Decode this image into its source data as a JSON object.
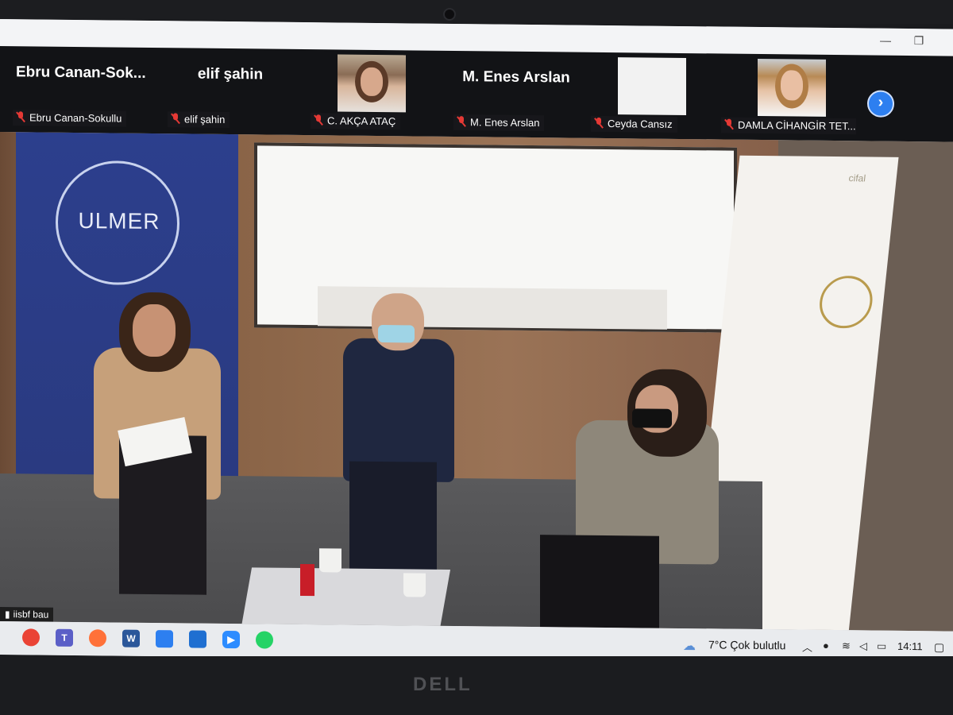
{
  "participants": [
    {
      "display": "Ebru  Canan-Sok...",
      "label": "Ebru Canan-Sokullu",
      "muted": true
    },
    {
      "display": "elif şahin",
      "label": "elif şahin",
      "muted": true
    },
    {
      "display": "",
      "label": "C. AKÇA ATAÇ",
      "muted": true
    },
    {
      "display": "M. Enes Arslan",
      "label": "M. Enes Arslan",
      "muted": true
    },
    {
      "display": "",
      "label": "Ceyda Cansız",
      "muted": true
    },
    {
      "display": "",
      "label": "DAMLA CİHANGİR TET...",
      "muted": true
    }
  ],
  "main_video": {
    "banner_text": "ULMER",
    "sponsor_text": "cifal",
    "speaker_label": "iisbf bau"
  },
  "taskbar": {
    "weather": "7°C  Çok bulutlu",
    "time": "14:11"
  },
  "device": {
    "brand": "DELL"
  },
  "colors": {
    "accent": "#2d7ff0",
    "muted_red": "#e53935",
    "banner_blue": "#2a3f8f"
  }
}
